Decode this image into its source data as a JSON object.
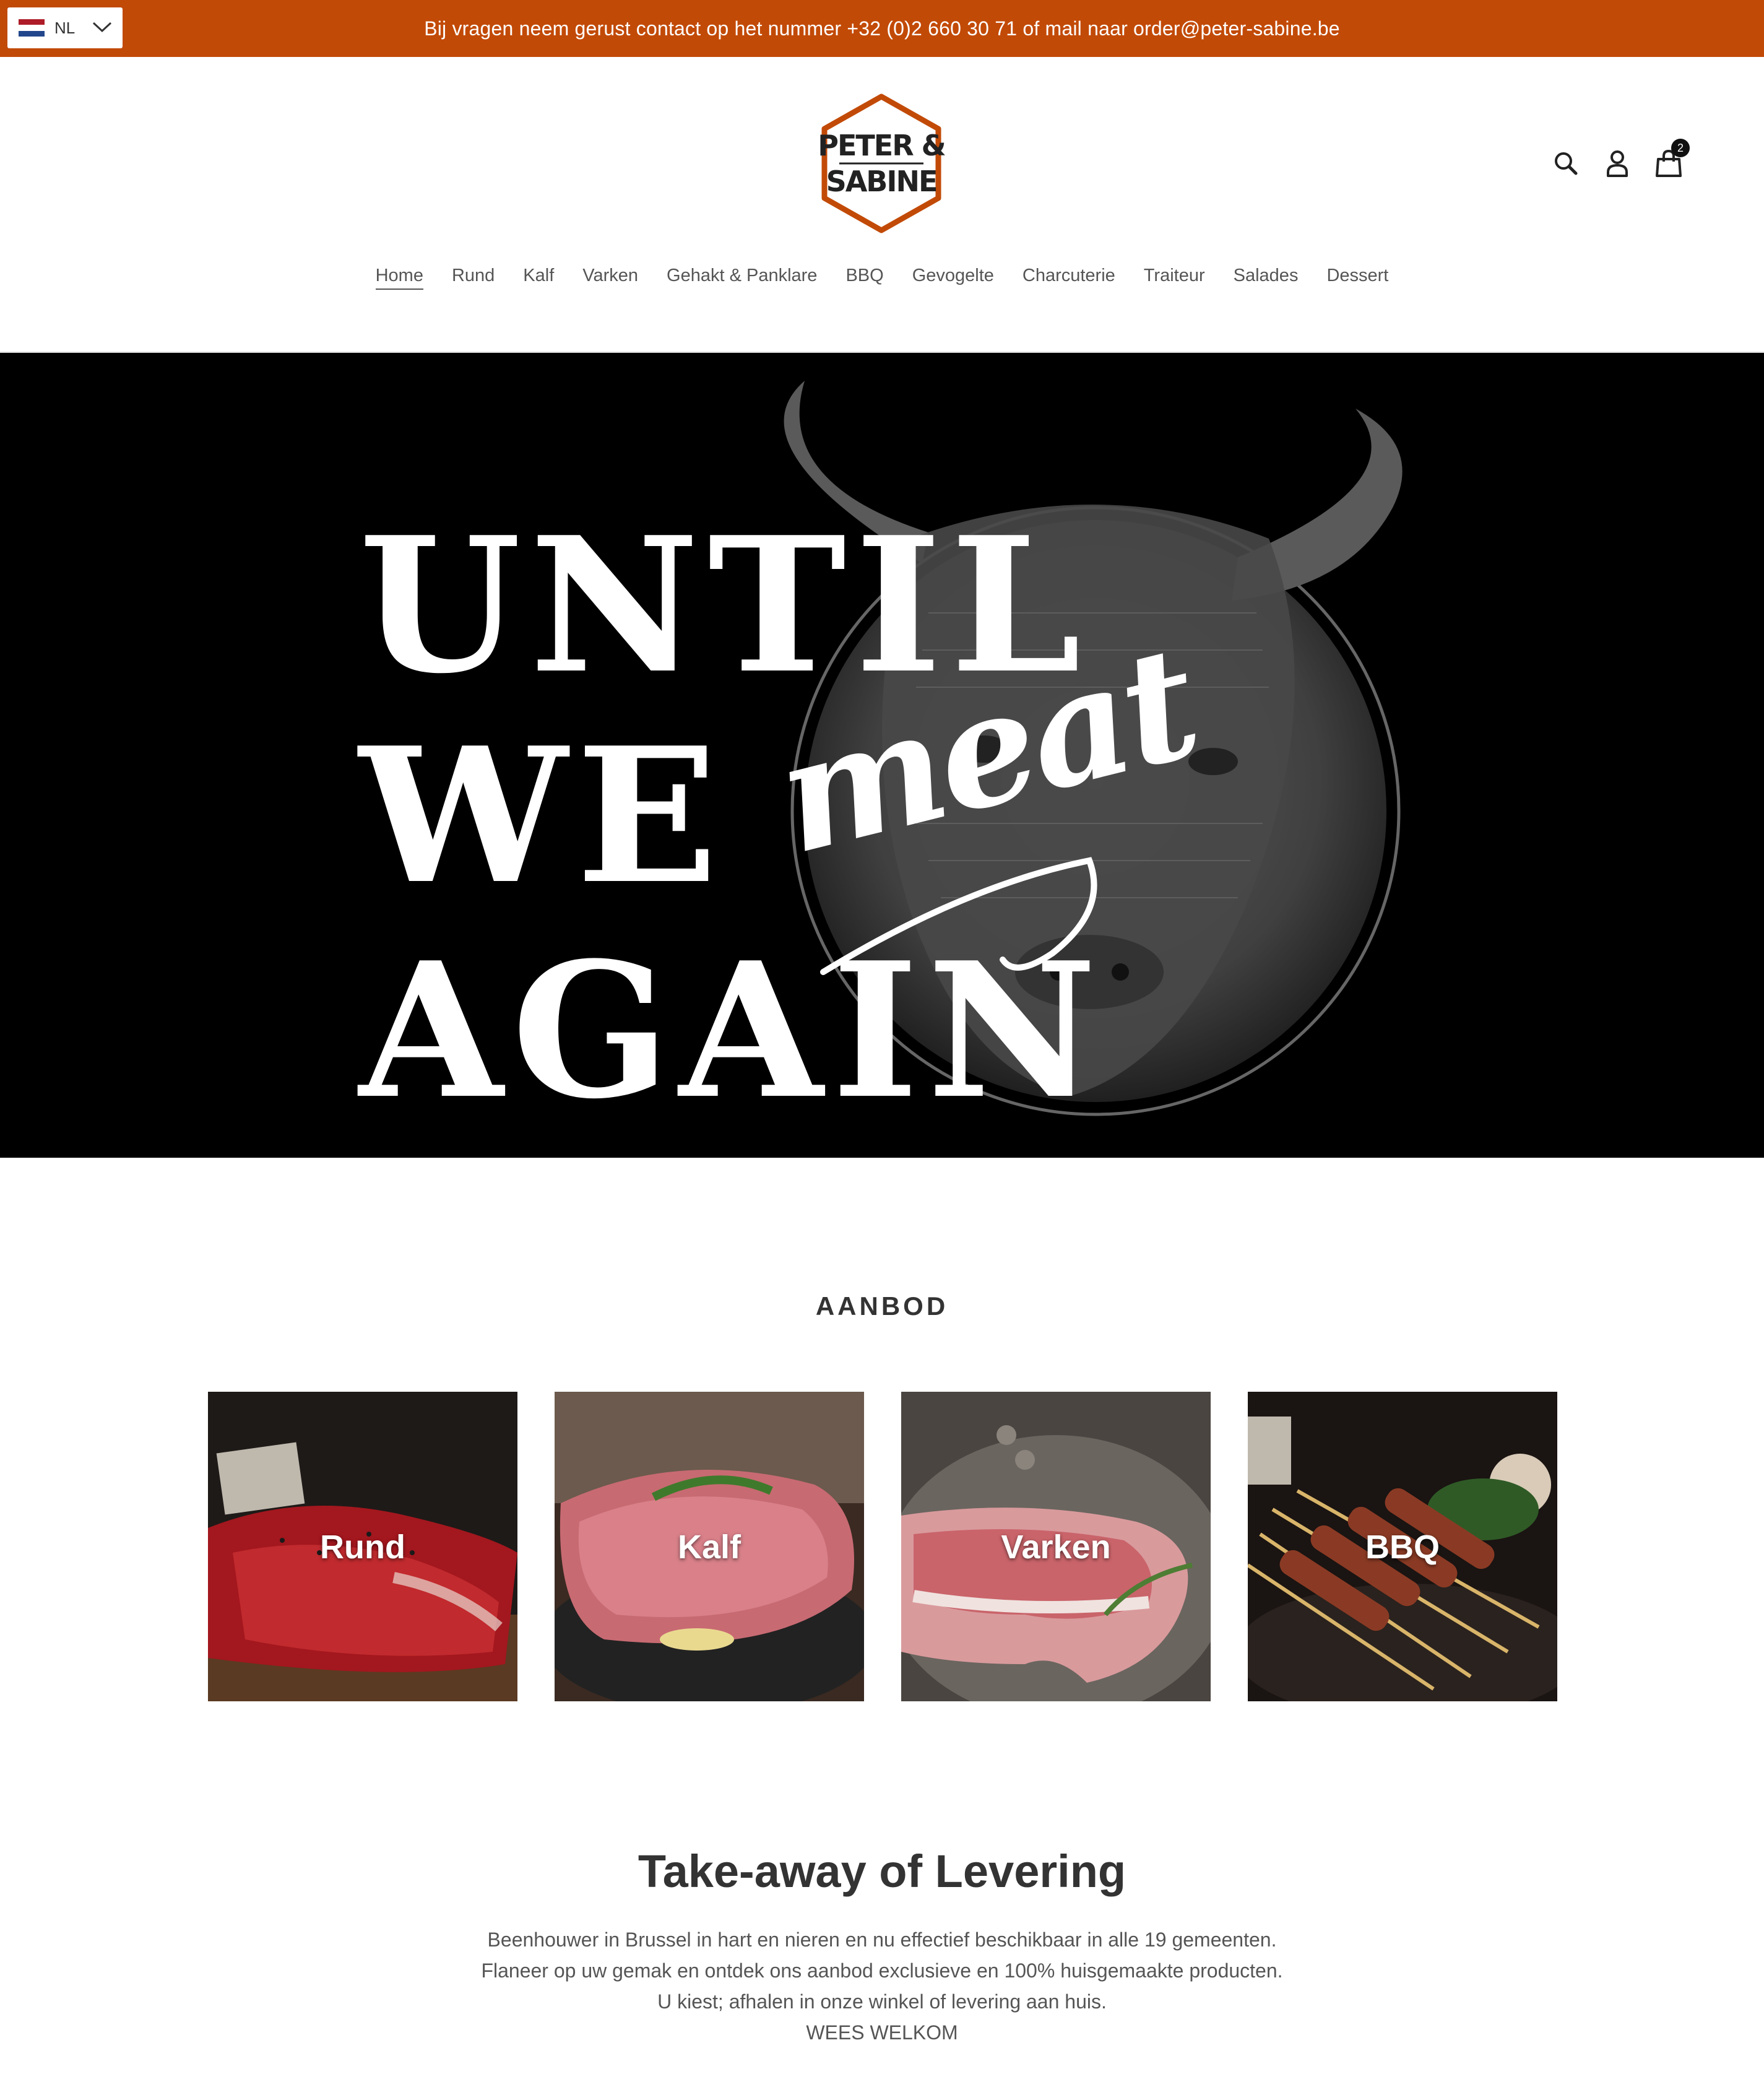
{
  "announcement": {
    "language": "NL",
    "text": "Bij vragen neem gerust contact op het nummer +32 (0)2 660 30 71 of mail naar order@peter-sabine.be",
    "bg_color": "#c24a07"
  },
  "logo": {
    "line1": "PETER &",
    "line2": "SABINE",
    "accent_color": "#c24a07"
  },
  "header_icons": {
    "search": "search-icon",
    "account": "user-icon",
    "cart": "bag-icon",
    "cart_count": "2"
  },
  "nav": {
    "items": [
      {
        "label": "Home",
        "active": true
      },
      {
        "label": "Rund"
      },
      {
        "label": "Kalf"
      },
      {
        "label": "Varken"
      },
      {
        "label": "Gehakt & Panklare"
      },
      {
        "label": "BBQ"
      },
      {
        "label": "Gevogelte"
      },
      {
        "label": "Charcuterie"
      },
      {
        "label": "Traiteur"
      },
      {
        "label": "Salades"
      },
      {
        "label": "Dessert"
      }
    ]
  },
  "hero": {
    "line1": "UNTIL",
    "line2": "WE",
    "script": "meat",
    "line3": "AGAIN"
  },
  "aanbod": {
    "title": "AANBOD",
    "tiles": [
      {
        "label": "Rund"
      },
      {
        "label": "Kalf"
      },
      {
        "label": "Varken"
      },
      {
        "label": "BBQ"
      }
    ]
  },
  "takeaway": {
    "title": "Take-away of Levering",
    "lines": [
      "Beenhouwer in Brussel in hart en nieren en nu effectief beschikbaar in alle 19 gemeenten.",
      "Flaneer op uw gemak en ontdek ons aanbod exclusieve en 100% huisgemaakte producten.",
      "U kiest; afhalen in onze winkel of levering aan huis.",
      "WEES WELKOM"
    ]
  }
}
